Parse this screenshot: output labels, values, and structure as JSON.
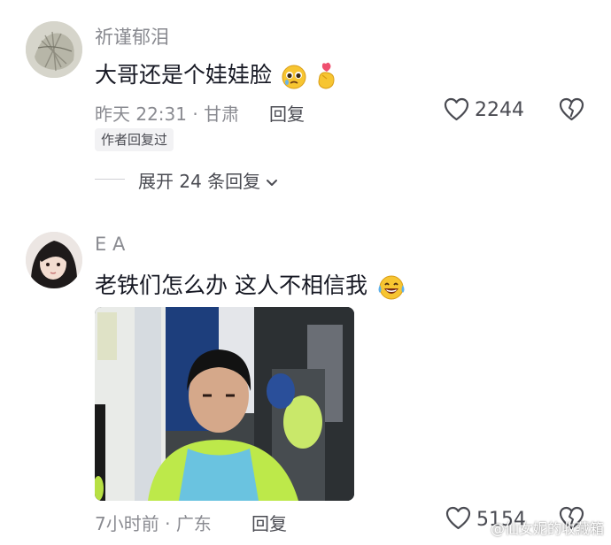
{
  "comments": [
    {
      "username": "祈谨郁泪",
      "text": "大哥还是个娃娃脸",
      "emojis": [
        "pleading-face",
        "finger-heart"
      ],
      "time": "昨天 22:31",
      "location": "甘肃",
      "reply_label": "回复",
      "likes": "2244",
      "author_tag": "作者回复过",
      "expand_label": "展开 24 条回复"
    },
    {
      "username": "E A",
      "text": "老铁们怎么办 这人不相信我",
      "emojis": [
        "laughing-tears-face"
      ],
      "time": "7小时前",
      "location": "广东",
      "reply_label": "回复",
      "likes": "5154"
    }
  ],
  "watermark": "@仙女妮的收藏箱",
  "colors": {
    "text_primary": "#161823",
    "text_secondary": "#8a8b91",
    "text_action": "#4a4b52",
    "tag_bg": "#f2f2f4"
  }
}
